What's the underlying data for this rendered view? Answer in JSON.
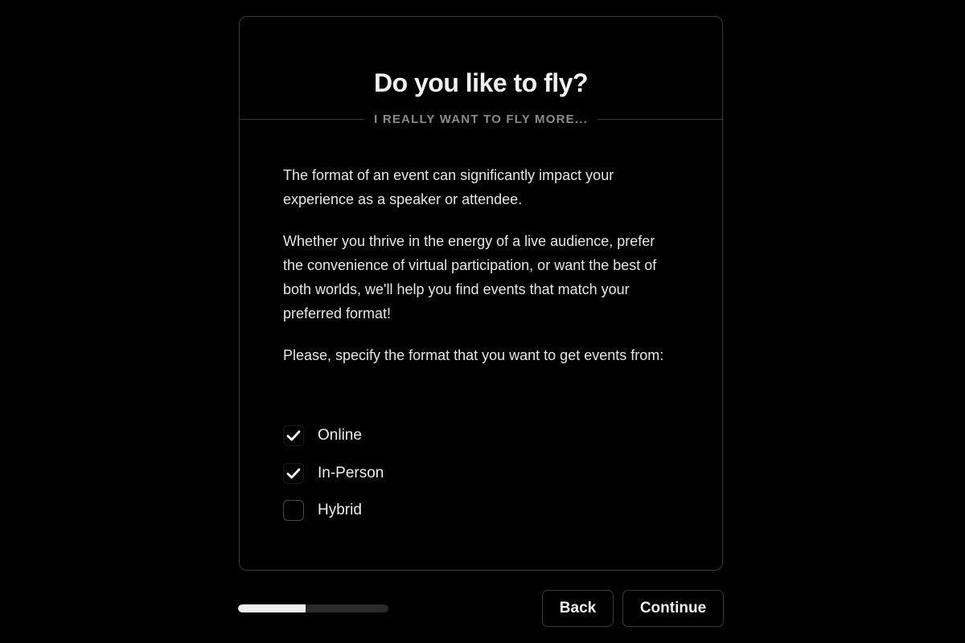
{
  "card": {
    "title": "Do you like to fly?",
    "subtitle": "I REALLY WANT TO FLY MORE...",
    "paragraphs": [
      "The format of an event can significantly impact your experience as a speaker or attendee.",
      "Whether you thrive in the energy of a live audience, prefer the convenience of virtual participation, or want the best of both worlds, we'll help you find events that match your preferred format!",
      "Please, specify the format that you want to get events from:"
    ],
    "options": [
      {
        "label": "Online",
        "checked": true,
        "icon": "check-icon"
      },
      {
        "label": "In-Person",
        "checked": true,
        "icon": "check-icon"
      },
      {
        "label": "Hybrid",
        "checked": false
      }
    ]
  },
  "footer": {
    "progress_percent": 45,
    "back_label": "Back",
    "continue_label": "Continue"
  },
  "colors": {
    "background": "#000000",
    "border": "#3a3a3a",
    "text": "#e6e6e6",
    "muted": "#8a8a8a",
    "progress_fill": "#efefef",
    "progress_track": "#2a2a2a"
  }
}
